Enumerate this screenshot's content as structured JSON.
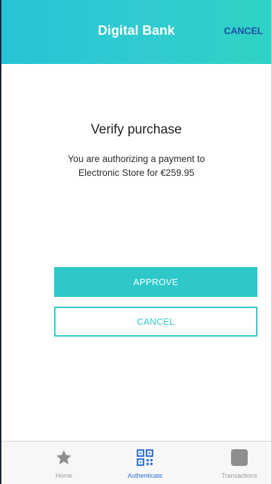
{
  "header": {
    "title": "Digital Bank",
    "cancel_label": "CANCEL"
  },
  "verify": {
    "title": "Verify purchase",
    "description_line1": "You are authorizing a payment to",
    "description_line2": "Electronic Store for €259.95"
  },
  "actions": {
    "approve_label": "APPROVE",
    "cancel_label": "CANCEL"
  },
  "tabbar": {
    "tabs": [
      {
        "label": "Home",
        "icon": "star-icon",
        "active": false
      },
      {
        "label": "Authenticate",
        "icon": "qr-code-icon",
        "active": true
      },
      {
        "label": "Transactions",
        "icon": "square-icon",
        "active": false
      }
    ]
  },
  "colors": {
    "header_gradient_start": "#27c3d6",
    "header_gradient_end": "#2fd2c3",
    "accent": "#2ec8c9",
    "cancel_header_text": "#1d4fa6",
    "active_tab": "#2b6fd6",
    "inactive_tab": "#9a9a9a"
  }
}
